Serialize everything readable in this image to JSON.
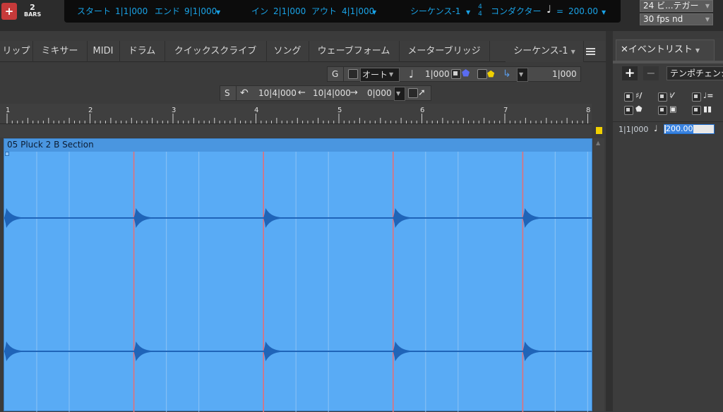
{
  "transport": {
    "record_glyph": "+",
    "bars_count": "2",
    "bars_label": "BARS",
    "start_label": "スタート",
    "start_value": "1|1|000",
    "end_label": "エンド",
    "end_value": "9|1|000",
    "in_label": "イン",
    "in_value": "2|1|000",
    "out_label": "アウト",
    "out_value": "4|1|000",
    "sequence_name": "シーケンス-1",
    "time_sig_top": "4",
    "time_sig_bottom": "4",
    "conductor_label": "コンダクター",
    "tempo_value": "200.00",
    "tempo_eq": "=",
    "tempo_note_glyph": "♩",
    "frame_rate_1": "24 ビ...テガー",
    "frame_rate_2": "30 fps nd"
  },
  "tabs": [
    {
      "label": "リップ"
    },
    {
      "label": "ミキサー"
    },
    {
      "label": "MIDI"
    },
    {
      "label": "ドラム"
    },
    {
      "label": "クイックスクライブ"
    },
    {
      "label": "ソング"
    },
    {
      "label": "ウェーブフォーム"
    },
    {
      "label": "メーターブリッジ"
    },
    {
      "label": "シーケンス-1"
    }
  ],
  "grid_toolbar": {
    "g_label": "G",
    "auto_label": "オート",
    "note_glyph": "♩",
    "grid_value": "1|000",
    "right_value": "1|000",
    "accent_blue": "#5a6cf0",
    "accent_yellow": "#f0d000",
    "arrow_color": "#5a9ae6"
  },
  "edit_toolbar": {
    "s_label": "S",
    "undo_icon": "undo-icon",
    "value_1": "10|4|000",
    "value_2": "10|4|000",
    "value_3": "0|000"
  },
  "ruler": {
    "bars": [
      "1",
      "2",
      "3",
      "4",
      "5",
      "6",
      "7",
      "8"
    ]
  },
  "clip": {
    "name": "05 Pluck 2 B Section",
    "color": "#59abf5",
    "waveform_color": "#1f64b8",
    "transient_color": "#e0707a",
    "beat_onsets": [
      1,
      2.5625,
      4.125,
      5.6875,
      7.25
    ]
  },
  "event_list": {
    "tab_title": "イベントリスト",
    "add_glyph": "+",
    "remove_glyph": "−",
    "type_filter": "テンポチェンジ",
    "row_position": "1|1|000",
    "row_note_glyph": "♩",
    "row_value": "200.00"
  }
}
